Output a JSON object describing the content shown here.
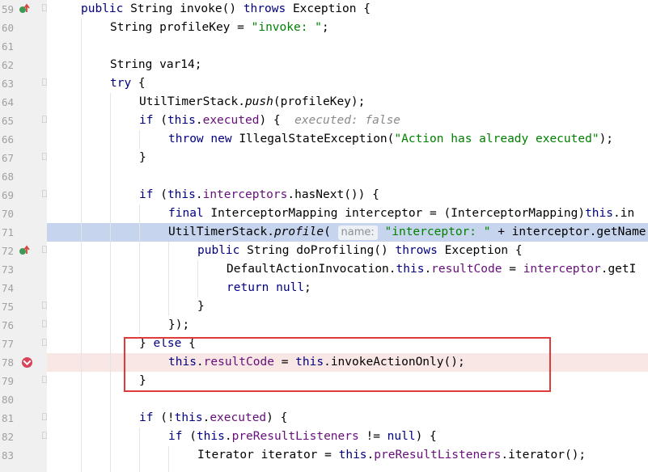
{
  "editor": {
    "lines": [
      {
        "num": "59",
        "segments": [
          {
            "t": "public",
            "c": "kw"
          },
          {
            "t": " String "
          },
          {
            "t": "invoke",
            "c": "mth"
          },
          {
            "t": "() "
          },
          {
            "t": "throws",
            "c": "kw"
          },
          {
            "t": " Exception {"
          }
        ]
      },
      {
        "num": "60",
        "segments": [
          {
            "t": "String profileKey = "
          },
          {
            "t": "\"invoke: \"",
            "c": "str"
          },
          {
            "t": ";"
          }
        ]
      },
      {
        "num": "61",
        "segments": []
      },
      {
        "num": "62",
        "segments": [
          {
            "t": "String var14;"
          }
        ]
      },
      {
        "num": "63",
        "segments": [
          {
            "t": "try",
            "c": "kw"
          },
          {
            "t": " {"
          }
        ]
      },
      {
        "num": "64",
        "segments": [
          {
            "t": "UtilTimerStack."
          },
          {
            "t": "push",
            "c": "it"
          },
          {
            "t": "(profileKey);"
          }
        ]
      },
      {
        "num": "65",
        "segments": [
          {
            "t": "if",
            "c": "kw"
          },
          {
            "t": " ("
          },
          {
            "t": "this",
            "c": "kw"
          },
          {
            "t": "."
          },
          {
            "t": "executed",
            "c": "fld"
          },
          {
            "t": ") {  "
          },
          {
            "t": "executed: false",
            "c": "inlay"
          }
        ]
      },
      {
        "num": "66",
        "segments": [
          {
            "t": "throw",
            "c": "kw"
          },
          {
            "t": " "
          },
          {
            "t": "new",
            "c": "kw"
          },
          {
            "t": " IllegalStateException("
          },
          {
            "t": "\"Action has already executed\"",
            "c": "str"
          },
          {
            "t": ");"
          }
        ]
      },
      {
        "num": "67",
        "segments": [
          {
            "t": "}"
          }
        ]
      },
      {
        "num": "68",
        "segments": []
      },
      {
        "num": "69",
        "segments": [
          {
            "t": "if",
            "c": "kw"
          },
          {
            "t": " ("
          },
          {
            "t": "this",
            "c": "kw"
          },
          {
            "t": "."
          },
          {
            "t": "interceptors",
            "c": "fld"
          },
          {
            "t": ".hasNext()) {"
          }
        ]
      },
      {
        "num": "70",
        "segments": [
          {
            "t": "final",
            "c": "kw"
          },
          {
            "t": " InterceptorMapping interceptor = (InterceptorMapping)"
          },
          {
            "t": "this",
            "c": "kw"
          },
          {
            "t": ".in"
          }
        ]
      },
      {
        "num": "71",
        "segments": [
          {
            "t": "UtilTimerStack."
          },
          {
            "t": "profile",
            "c": "it"
          },
          {
            "t": "( "
          },
          {
            "t": "name:",
            "c": "hint"
          },
          {
            "t": " "
          },
          {
            "t": "\"interceptor: \"",
            "c": "str"
          },
          {
            "t": " + interceptor.getName"
          }
        ]
      },
      {
        "num": "72",
        "segments": [
          {
            "t": "public",
            "c": "kw"
          },
          {
            "t": " String "
          },
          {
            "t": "doProfiling",
            "c": "mth"
          },
          {
            "t": "() "
          },
          {
            "t": "throws",
            "c": "kw"
          },
          {
            "t": " Exception {"
          }
        ]
      },
      {
        "num": "73",
        "segments": [
          {
            "t": "DefaultActionInvocation."
          },
          {
            "t": "this",
            "c": "kw"
          },
          {
            "t": "."
          },
          {
            "t": "resultCode",
            "c": "fld"
          },
          {
            "t": " = "
          },
          {
            "t": "interceptor",
            "c": "fld"
          },
          {
            "t": ".getI"
          }
        ]
      },
      {
        "num": "74",
        "segments": [
          {
            "t": "return",
            "c": "kw"
          },
          {
            "t": " "
          },
          {
            "t": "null",
            "c": "kw"
          },
          {
            "t": ";"
          }
        ]
      },
      {
        "num": "75",
        "segments": [
          {
            "t": "}"
          }
        ]
      },
      {
        "num": "76",
        "segments": [
          {
            "t": "});"
          }
        ]
      },
      {
        "num": "77",
        "segments": [
          {
            "t": "} "
          },
          {
            "t": "else",
            "c": "kw"
          },
          {
            "t": " {"
          }
        ]
      },
      {
        "num": "78",
        "segments": [
          {
            "t": "this",
            "c": "kw"
          },
          {
            "t": "."
          },
          {
            "t": "resultCode",
            "c": "fld"
          },
          {
            "t": " = "
          },
          {
            "t": "this",
            "c": "kw"
          },
          {
            "t": ".invokeActionOnly();"
          }
        ]
      },
      {
        "num": "79",
        "segments": [
          {
            "t": "}"
          }
        ]
      },
      {
        "num": "80",
        "segments": []
      },
      {
        "num": "81",
        "segments": [
          {
            "t": "if",
            "c": "kw"
          },
          {
            "t": " (!"
          },
          {
            "t": "this",
            "c": "kw"
          },
          {
            "t": "."
          },
          {
            "t": "executed",
            "c": "fld"
          },
          {
            "t": ") {"
          }
        ]
      },
      {
        "num": "82",
        "segments": [
          {
            "t": "if",
            "c": "kw"
          },
          {
            "t": " ("
          },
          {
            "t": "this",
            "c": "kw"
          },
          {
            "t": "."
          },
          {
            "t": "preResultListeners",
            "c": "fld"
          },
          {
            "t": " != "
          },
          {
            "t": "null",
            "c": "kw"
          },
          {
            "t": ") {"
          }
        ]
      },
      {
        "num": "83",
        "segments": [
          {
            "t": "Iterator iterator = "
          },
          {
            "t": "this",
            "c": "kw"
          },
          {
            "t": "."
          },
          {
            "t": "preResultListeners",
            "c": "fld"
          },
          {
            "t": ".iterator();"
          }
        ]
      }
    ],
    "highlights": {
      "blue_line": "71",
      "pink_line": "78"
    },
    "colors": {
      "keyword": "#000080",
      "string": "#008000",
      "field": "#660e7a",
      "method": "#00627a",
      "gutter": "#f0f0f0",
      "blue_highlight": "#c6d4ee",
      "pink_highlight": "#f9e7e5",
      "annotation_box": "#e03b3b"
    },
    "icons": {
      "override_marker": "override-up-arrow-icon",
      "breakpoint": "breakpoint-icon"
    }
  }
}
